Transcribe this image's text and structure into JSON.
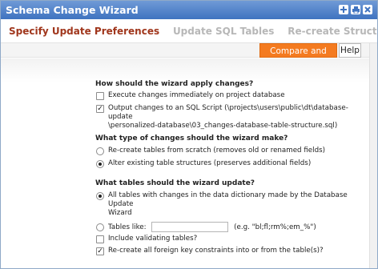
{
  "window": {
    "title": "Schema Change Wizard"
  },
  "title_icons": [
    "add-icon",
    "print-icon",
    "close-icon"
  ],
  "tabs": [
    {
      "label": "Specify Update Preferences",
      "active": true
    },
    {
      "label": "Update SQL Tables",
      "active": false
    },
    {
      "label": "Re-create Structures",
      "active": false
    }
  ],
  "toolbar": {
    "compare_label": "Compare and Next",
    "help_label": "Help"
  },
  "sections": {
    "apply": {
      "question": "How should the wizard apply changes?",
      "opt_execute": "Execute changes immediately on project database",
      "opt_script_line1": "Output changes to an SQL Script (\\projects\\users\\public\\dt\\database-update",
      "opt_script_line2": "\\personalized-database\\03_changes-database-table-structure.sql)"
    },
    "type": {
      "question": "What type of changes should the wizard make?",
      "opt_recreate": "Re-create tables from scratch (removes old or renamed fields)",
      "opt_alter": "Alter existing table structures (preserves additional fields)"
    },
    "tables": {
      "question": "What tables should the wizard update?",
      "opt_all_line1": "All tables with changes in the data dictionary made by the Database Update",
      "opt_all_line2": "Wizard",
      "opt_like_label": "Tables like:",
      "opt_like_hint": "(e.g. \"bl;fl;rm%;em_%\")",
      "opt_like_value": ""
    },
    "extra": {
      "opt_validating": "Include validating tables?",
      "opt_fk": "Re-create all foreign key constraints into or from the table(s)?"
    }
  },
  "colors": {
    "accent": "#f47b20",
    "active_tab": "#a0361c",
    "title_bar": "#3f73c0"
  }
}
